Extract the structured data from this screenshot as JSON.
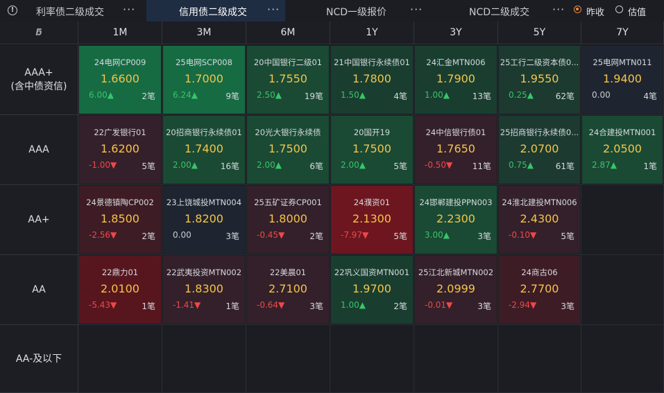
{
  "tabs": [
    {
      "label": "利率债二级成交"
    },
    {
      "label": "信用债二级成交"
    },
    {
      "label": "NCD一级报价"
    },
    {
      "label": "NCD二级成交"
    }
  ],
  "more_glyph": "···",
  "radio": {
    "close_label": "昨收",
    "valuation_label": "估值",
    "selected": "昨收"
  },
  "corner_logo": "ƃ",
  "columns": [
    "1M",
    "3M",
    "6M",
    "1Y",
    "3Y",
    "5Y",
    "7Y"
  ],
  "rows": [
    {
      "label_line1": "AAA+",
      "label_line2": "(含中债资信)"
    },
    {
      "label_line1": "AAA",
      "label_line2": ""
    },
    {
      "label_line1": "AA+",
      "label_line2": ""
    },
    {
      "label_line1": "AA",
      "label_line2": ""
    },
    {
      "label_line1": "AA-及以下",
      "label_line2": ""
    }
  ],
  "colors": {
    "green_bg": "#15482f",
    "green_bg_light": "#13553a",
    "red_bg": "#3a1c22",
    "red_bg_strong": "#5a151d",
    "neutral_bg": "#1e2530",
    "price": "#f4c54a",
    "up": "#38c46a",
    "down": "#f0474a"
  },
  "cells": [
    [
      {
        "name": "24电网CP009",
        "price": "1.6600",
        "change": "6.00▲",
        "dir": "up",
        "count": "2笔",
        "bg": "#166b43"
      },
      {
        "name": "25电网SCP008",
        "price": "1.7000",
        "change": "6.24▲",
        "dir": "up",
        "count": "9笔",
        "bg": "#166b43"
      },
      {
        "name": "20中国银行二级01",
        "price": "1.7550",
        "change": "2.50▲",
        "dir": "up",
        "count": "19笔",
        "bg": "#1a4a34"
      },
      {
        "name": "21中国银行永续债01",
        "price": "1.7800",
        "change": "1.50▲",
        "dir": "up",
        "count": "4笔",
        "bg": "#193e30"
      },
      {
        "name": "24汇金MTN006",
        "price": "1.7900",
        "change": "1.00▲",
        "dir": "up",
        "count": "13笔",
        "bg": "#193e30"
      },
      {
        "name": "25工行二级资本债0...",
        "price": "1.9550",
        "change": "0.25▲",
        "dir": "up",
        "count": "62笔",
        "bg": "#1c3a30"
      },
      {
        "name": "25电网MTN011",
        "price": "1.9400",
        "change": "0.00",
        "dir": "flat",
        "count": "4笔",
        "bg": "#1f2530"
      }
    ],
    [
      {
        "name": "22广发银行01",
        "price": "1.6200",
        "change": "-1.00▼",
        "dir": "down",
        "count": "5笔",
        "bg": "#34202a"
      },
      {
        "name": "20招商银行永续债01",
        "price": "1.7400",
        "change": "2.00▲",
        "dir": "up",
        "count": "16笔",
        "bg": "#1a4a34"
      },
      {
        "name": "20光大银行永续债",
        "price": "1.7500",
        "change": "2.00▲",
        "dir": "up",
        "count": "6笔",
        "bg": "#1a4a34"
      },
      {
        "name": "20国开19",
        "price": "1.7500",
        "change": "2.00▲",
        "dir": "up",
        "count": "5笔",
        "bg": "#1a4a34"
      },
      {
        "name": "24中信银行债01",
        "price": "1.7650",
        "change": "-0.50▼",
        "dir": "down",
        "count": "11笔",
        "bg": "#34202a"
      },
      {
        "name": "25招商银行永续债0...",
        "price": "2.0700",
        "change": "0.75▲",
        "dir": "up",
        "count": "61笔",
        "bg": "#1c3a30"
      },
      {
        "name": "24合建投MTN001",
        "price": "2.0500",
        "change": "2.87▲",
        "dir": "up",
        "count": "1笔",
        "bg": "#1a4a34"
      }
    ],
    [
      {
        "name": "24景德镇陶CP002",
        "price": "1.8500",
        "change": "-2.56▼",
        "dir": "down",
        "count": "2笔",
        "bg": "#3e1c25"
      },
      {
        "name": "23上饶城投MTN004",
        "price": "1.8200",
        "change": "0.00",
        "dir": "flat",
        "count": "3笔",
        "bg": "#1f2530"
      },
      {
        "name": "25五矿证券CP001",
        "price": "1.8000",
        "change": "-0.45▼",
        "dir": "down",
        "count": "2笔",
        "bg": "#34202a"
      },
      {
        "name": "24濮资01",
        "price": "2.1300",
        "change": "-7.97▼",
        "dir": "down",
        "count": "5笔",
        "bg": "#6e161f"
      },
      {
        "name": "24邯郸建投PPN003",
        "price": "2.2300",
        "change": "3.00▲",
        "dir": "up",
        "count": "3笔",
        "bg": "#1a4a34"
      },
      {
        "name": "24淮北建投MTN006",
        "price": "2.4300",
        "change": "-0.10▼",
        "dir": "down",
        "count": "5笔",
        "bg": "#34202a"
      },
      null
    ],
    [
      {
        "name": "22鼎力01",
        "price": "2.0100",
        "change": "-5.43▼",
        "dir": "down",
        "count": "1笔",
        "bg": "#57161e"
      },
      {
        "name": "22武夷投资MTN002",
        "price": "1.8300",
        "change": "-1.41▼",
        "dir": "down",
        "count": "1笔",
        "bg": "#34202a"
      },
      {
        "name": "22美晨01",
        "price": "2.7100",
        "change": "-0.64▼",
        "dir": "down",
        "count": "3笔",
        "bg": "#34202a"
      },
      {
        "name": "22巩义国资MTN001",
        "price": "1.9700",
        "change": "1.00▲",
        "dir": "up",
        "count": "2笔",
        "bg": "#193e30"
      },
      {
        "name": "25江北新城MTN002",
        "price": "2.0999",
        "change": "-0.01▼",
        "dir": "down",
        "count": "3笔",
        "bg": "#34202a"
      },
      {
        "name": "24商古06",
        "price": "2.7700",
        "change": "-2.94▼",
        "dir": "down",
        "count": "3笔",
        "bg": "#3e1c25"
      },
      null
    ],
    [
      null,
      null,
      null,
      null,
      null,
      null,
      null
    ]
  ]
}
